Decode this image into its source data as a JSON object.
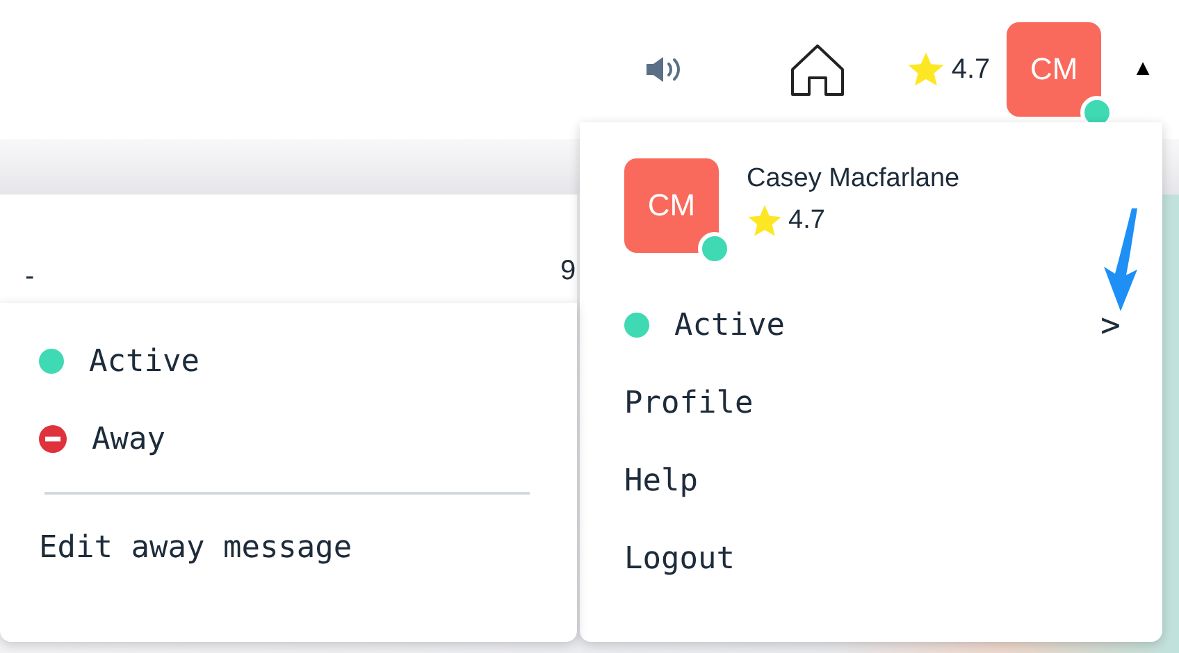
{
  "topbar": {
    "rating": "4.7",
    "avatar": {
      "initials": "CM",
      "online": true
    },
    "caret": "▲"
  },
  "background": {
    "fragments": [
      "-",
      "9"
    ]
  },
  "profile_menu": {
    "name": "Casey Macfarlane",
    "rating": "4.7",
    "avatar": {
      "initials": "CM",
      "online": true
    },
    "items": [
      {
        "kind": "status",
        "label": "Active",
        "color": "#3fd9b4",
        "chevron": ">"
      },
      {
        "kind": "link",
        "label": "Profile"
      },
      {
        "kind": "link",
        "label": "Help"
      },
      {
        "kind": "link",
        "label": "Logout"
      }
    ]
  },
  "status_submenu": {
    "options": [
      {
        "kind": "dot",
        "label": "Active",
        "color": "#3fd9b4"
      },
      {
        "kind": "blocked",
        "label": "Away",
        "color": "#e0323c"
      }
    ],
    "action": "Edit away message"
  }
}
